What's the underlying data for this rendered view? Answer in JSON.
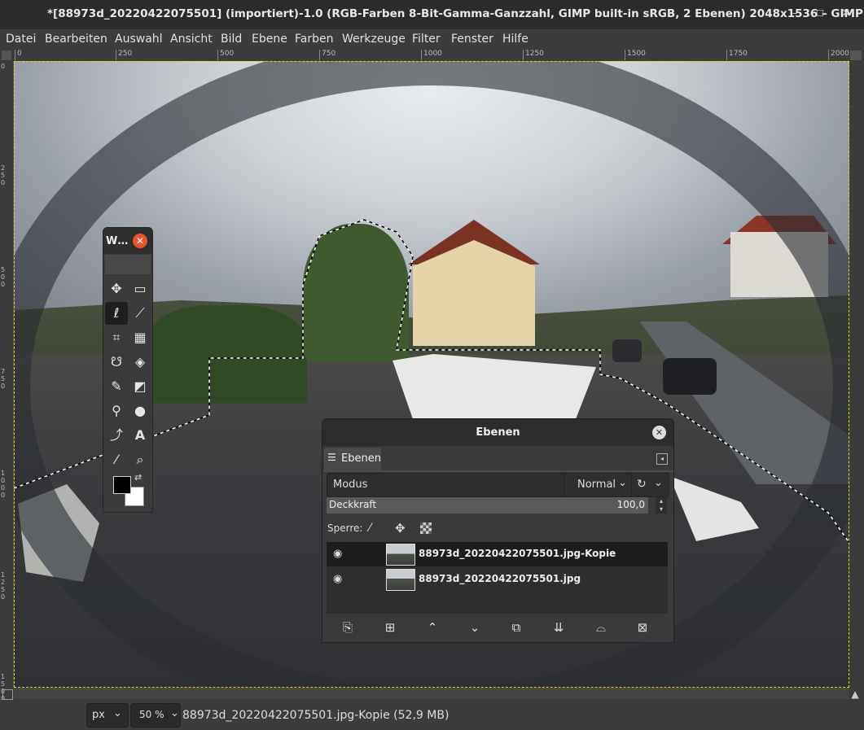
{
  "window": {
    "title": "*[88973d_20220422075501] (importiert)-1.0 (RGB-Farben 8-Bit-Gamma-Ganzzahl, GIMP built-in sRGB, 2 Ebenen) 2048x1536 – GIMP",
    "minimize": "–",
    "maximize": "☐",
    "close": "✕"
  },
  "menubar": [
    "Datei",
    "Bearbeiten",
    "Auswahl",
    "Ansicht",
    "Bild",
    "Ebene",
    "Farben",
    "Werkzeuge",
    "Filter",
    "Fenster",
    "Hilfe"
  ],
  "ruler_top": [
    "0",
    "250",
    "500",
    "750",
    "1000",
    "1250",
    "1500",
    "1750",
    "2000"
  ],
  "ruler_left": [
    "0",
    "250",
    "500",
    "750",
    "1000",
    "1250",
    "1500"
  ],
  "toolbox": {
    "title": "W…",
    "close": "✕",
    "tools": [
      {
        "icon": "move-icon",
        "glyph": "✥"
      },
      {
        "icon": "rect-select-icon",
        "glyph": "▭"
      },
      {
        "icon": "free-select-icon",
        "glyph": "ℓ"
      },
      {
        "icon": "fuzzy-select-icon",
        "glyph": "⟋"
      },
      {
        "icon": "crop-icon",
        "glyph": "⌗"
      },
      {
        "icon": "unified-transform-icon",
        "glyph": "▦"
      },
      {
        "icon": "warp-transform-icon",
        "glyph": "☋"
      },
      {
        "icon": "bucket-fill-icon",
        "glyph": "◈"
      },
      {
        "icon": "paintbrush-icon",
        "glyph": "✎"
      },
      {
        "icon": "eraser-icon",
        "glyph": "◩"
      },
      {
        "icon": "clone-icon",
        "glyph": "⚲"
      },
      {
        "icon": "smudge-icon",
        "glyph": "●"
      },
      {
        "icon": "paths-icon",
        "glyph": "⤴"
      },
      {
        "icon": "text-icon",
        "glyph": "A"
      },
      {
        "icon": "color-picker-icon",
        "glyph": "⁄"
      },
      {
        "icon": "zoom-icon",
        "glyph": "⌕"
      }
    ],
    "swap_glyph": "⇄",
    "fg_color": "#000000",
    "bg_color": "#ffffff"
  },
  "layers_dialog": {
    "title": "Ebenen",
    "close": "✕",
    "tab_label": "Ebenen",
    "mode_label": "Modus",
    "mode_value": "Normal",
    "opacity_label": "Deckkraft",
    "opacity_value": "100,0",
    "lock_label": "Sperre:",
    "layers": [
      {
        "name": "88973d_20220422075501.jpg-Kopie",
        "visible": true,
        "selected": true
      },
      {
        "name": "88973d_20220422075501.jpg",
        "visible": true,
        "selected": false
      }
    ],
    "buttons": [
      "new-layer-icon",
      "new-group-icon",
      "raise-layer-icon",
      "lower-layer-icon",
      "duplicate-layer-icon",
      "merge-down-icon",
      "mask-icon",
      "delete-layer-icon"
    ]
  },
  "statusbar": {
    "unit": "px",
    "zoom": "50 %",
    "info": "88973d_20220422075501.jpg-Kopie (52,9 MB)"
  },
  "colors": {
    "selection_marching_ants": "#ffffff",
    "canvas_boundary": "#e6d800",
    "toolbox_close": "#e9542b"
  }
}
